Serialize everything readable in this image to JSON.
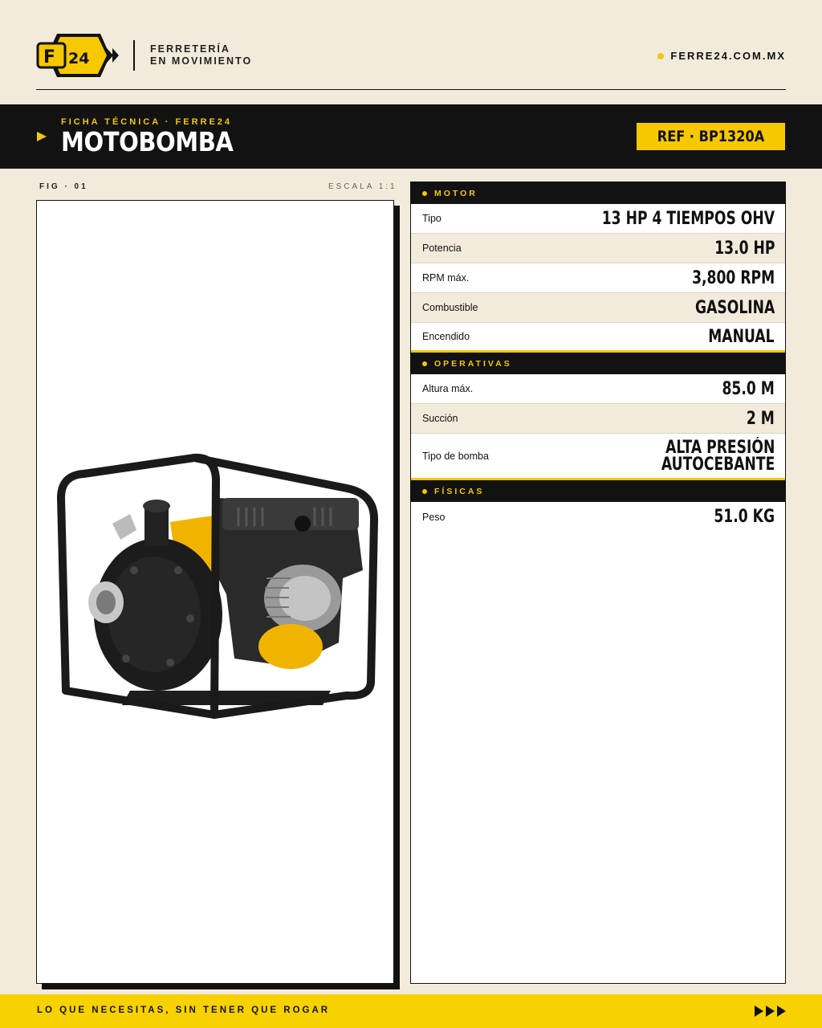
{
  "header": {
    "logo_text": "F24",
    "tagline_line1": "FERRETERÍA",
    "tagline_line2": "EN MOVIMIENTO",
    "site": "FERRE24.COM.MX"
  },
  "title_band": {
    "eyebrow": "FICHA TÉCNICA · FERRE24",
    "title": "MOTOBOMBA",
    "ref": "REF · BP1320A"
  },
  "figure": {
    "label": "FIG · 01",
    "scale": "ESCALA 1:1"
  },
  "specs": {
    "motor": {
      "title": "MOTOR",
      "rows": [
        {
          "label": "Tipo",
          "value": "13 HP 4 TIEMPOS OHV"
        },
        {
          "label": "Potencia",
          "value": "13.0 HP"
        },
        {
          "label": "RPM máx.",
          "value": "3,800 RPM"
        },
        {
          "label": "Combustible",
          "value": "GASOLINA"
        },
        {
          "label": "Encendido",
          "value": "MANUAL"
        }
      ]
    },
    "operativas": {
      "title": "OPERATIVAS",
      "rows": [
        {
          "label": "Altura máx.",
          "value": "85.0 M"
        },
        {
          "label": "Succión",
          "value": "2 M"
        },
        {
          "label": "Tipo de bomba",
          "value_line1": "ALTA PRESIÓN",
          "value_line2": "AUTOCEBANTE"
        }
      ]
    },
    "fisicas": {
      "title": "FÍSICAS",
      "rows": [
        {
          "label": "Peso",
          "value": "51.0 KG"
        }
      ]
    }
  },
  "footer": {
    "slogan": "LO QUE NECESITAS, SIN TENER QUE ROGAR"
  },
  "colors": {
    "accent": "#f6c800",
    "dark": "#121212",
    "background": "#f2ebdb"
  }
}
